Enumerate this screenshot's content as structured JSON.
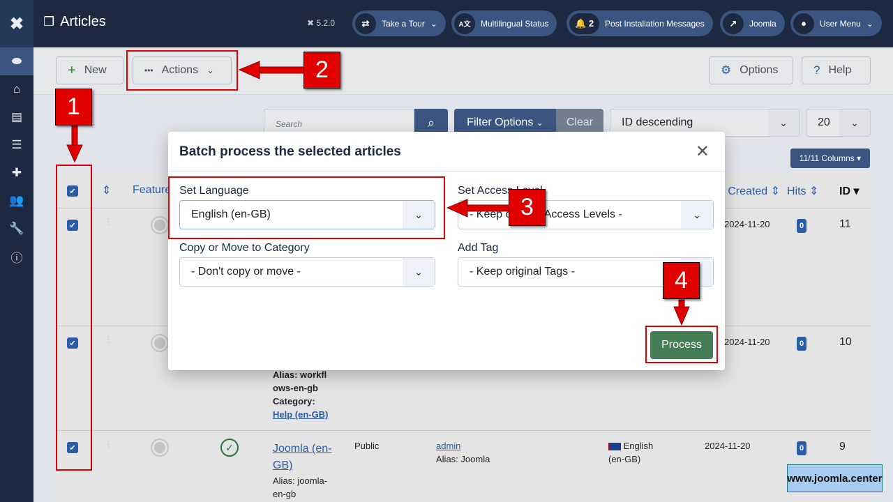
{
  "header": {
    "title": "Articles",
    "version": "5.2.0",
    "pills": [
      {
        "label": "Take a Tour",
        "icon": "signpost-icon",
        "has_chevron": true
      },
      {
        "label": "Multilingual Status",
        "icon": "language-icon"
      },
      {
        "label": "Post Installation Messages",
        "icon": "bell-icon",
        "count": "2"
      },
      {
        "label": "Joomla",
        "icon": "external-link-icon"
      },
      {
        "label": "User Menu",
        "icon": "user-icon",
        "has_chevron": true
      }
    ]
  },
  "sidebar": {
    "items": [
      "toggle-menu",
      "home",
      "content",
      "menus",
      "components",
      "users",
      "system",
      "help"
    ]
  },
  "toolbar": {
    "new_label": "New",
    "actions_label": "Actions",
    "options_label": "Options",
    "help_label": "Help"
  },
  "filters": {
    "search_placeholder": "Search",
    "filter_options_label": "Filter Options",
    "clear_label": "Clear",
    "ordering": "ID descending",
    "limit": "20",
    "columns_label": "11/11 Columns"
  },
  "table": {
    "headers": {
      "featured": "Featured",
      "created": "Date Created",
      "hits": "Hits",
      "id": "ID"
    },
    "rows": [
      {
        "id": "11",
        "hits": "0",
        "created": "2024-11-20",
        "checked": true
      },
      {
        "id": "10",
        "hits": "0",
        "created": "2024-11-20",
        "checked": true,
        "alias": "Alias: workflows-en-gb",
        "category_label": "Category:",
        "category": "Help (en-GB)"
      },
      {
        "id": "9",
        "hits": "0",
        "created": "2024-11-20",
        "checked": true,
        "title": "Joomla (en-GB)",
        "alias": "Alias: joomla-en-gb",
        "access": "Public",
        "author": "admin",
        "author_alias": "Alias: Joomla",
        "language": "English (en-GB)"
      }
    ]
  },
  "modal": {
    "title": "Batch process the selected articles",
    "fields": {
      "language": {
        "label": "Set Language",
        "value": "English (en-GB)"
      },
      "access": {
        "label": "Set Access Level",
        "value": "- Keep original Access Levels -"
      },
      "category": {
        "label": "Copy or Move to Category",
        "value": "- Don't copy or move -"
      },
      "tag": {
        "label": "Add Tag",
        "value": "- Keep original Tags -"
      }
    },
    "process_label": "Process"
  },
  "annotations": [
    "1",
    "2",
    "3",
    "4"
  ],
  "colors": {
    "accent": "#3a5580",
    "header": "#1c2941",
    "process": "#457d54",
    "annotation": "#e00000"
  },
  "watermark": "www.joomla.center"
}
